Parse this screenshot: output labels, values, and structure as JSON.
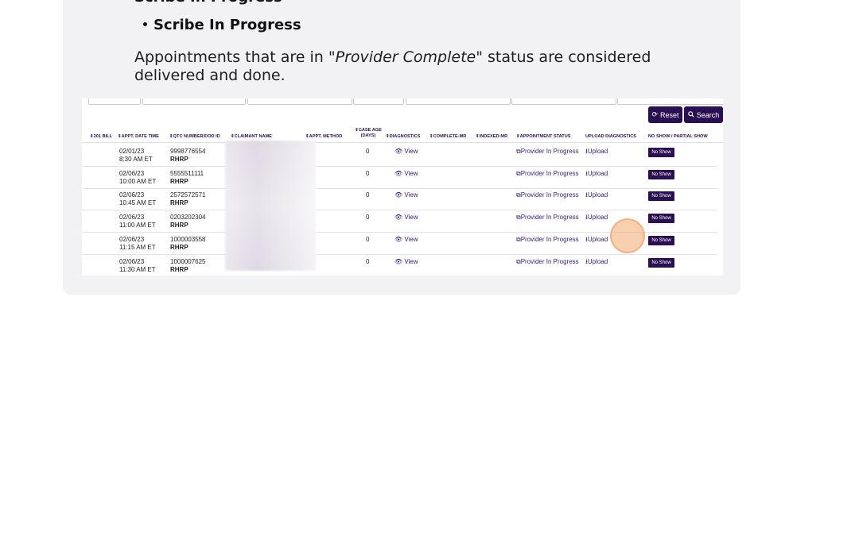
{
  "heading_partial": "Scribe In Progress",
  "bullet_marker": "•",
  "bullet_label": "Scribe In Progress",
  "paragraph": {
    "before": "Appointments that are in \"",
    "italic": "Provider Complete",
    "after": "\" status are considered delivered and done."
  },
  "embedded_screenshot": {
    "buttons": {
      "reset_icon": "refresh-icon",
      "reset_label": "Reset",
      "search_icon": "search-icon",
      "search_label": "Search"
    },
    "columns": {
      "bill": "⇕201 BILL",
      "appt_date_time": "⇕APPT. DATE TIME",
      "qtc_number": "⇕QTC NUMBER/DOD ID",
      "claimant_name": "⇕CLAIMANT NAME",
      "appt_method": "⇕APPT. METHOD",
      "case_age_1": "⇕CASE AGE",
      "case_age_2": "(DAYS)",
      "diagnostics": "⇕DIAGNOSTICS",
      "complete_mr": "⇕COMPLETE-MR",
      "indexed_mr": "⇕INDEXED-MR",
      "appointment_status": "⇕APPOINTMENT STATUS",
      "upload_diagnostics": "UPLOAD DIAGNOSTICS",
      "no_show": "NO SHOW / PARTIAL SHOW"
    },
    "rows": [
      {
        "date": "02/01/23",
        "time": "8:30 AM ET",
        "qtc": "9998776554",
        "code": "RHRP",
        "case_age": "0",
        "diagnostics": "View",
        "status": "Provider In Progress",
        "upload": "Upload",
        "no_show": "No Show"
      },
      {
        "date": "02/06/23",
        "time": "10:00 AM ET",
        "qtc": "5555511111",
        "code": "RHRP",
        "case_age": "0",
        "diagnostics": "View",
        "status": "Provider In Progress",
        "upload": "Upload",
        "no_show": "No Show"
      },
      {
        "date": "02/06/23",
        "time": "10:45 AM ET",
        "qtc": "2572572571",
        "code": "RHRP",
        "case_age": "0",
        "diagnostics": "View",
        "status": "Provider In Progress",
        "upload": "Upload",
        "no_show": "No Show"
      },
      {
        "date": "02/06/23",
        "time": "11:00 AM ET",
        "qtc": "0203202304",
        "code": "RHRP",
        "case_age": "0",
        "diagnostics": "View",
        "status": "Provider In Progress",
        "upload": "Upload",
        "no_show": "No Show"
      },
      {
        "date": "02/06/23",
        "time": "11:15 AM ET",
        "qtc": "1000003558",
        "code": "RHRP",
        "case_age": "0",
        "diagnostics": "View",
        "status": "Provider In Progress",
        "upload": "Upload",
        "no_show": "No Show"
      },
      {
        "date": "02/06/23",
        "time": "11:30 AM ET",
        "qtc": "1000007625",
        "code": "RHRP",
        "case_age": "0",
        "diagnostics": "View",
        "status": "Provider In Progress",
        "upload": "Upload",
        "no_show": "No Show"
      }
    ]
  },
  "colors": {
    "brand_purple": "#2a0f52",
    "card_bg": "#f2f2f5",
    "highlight": "#f4aa6e"
  }
}
